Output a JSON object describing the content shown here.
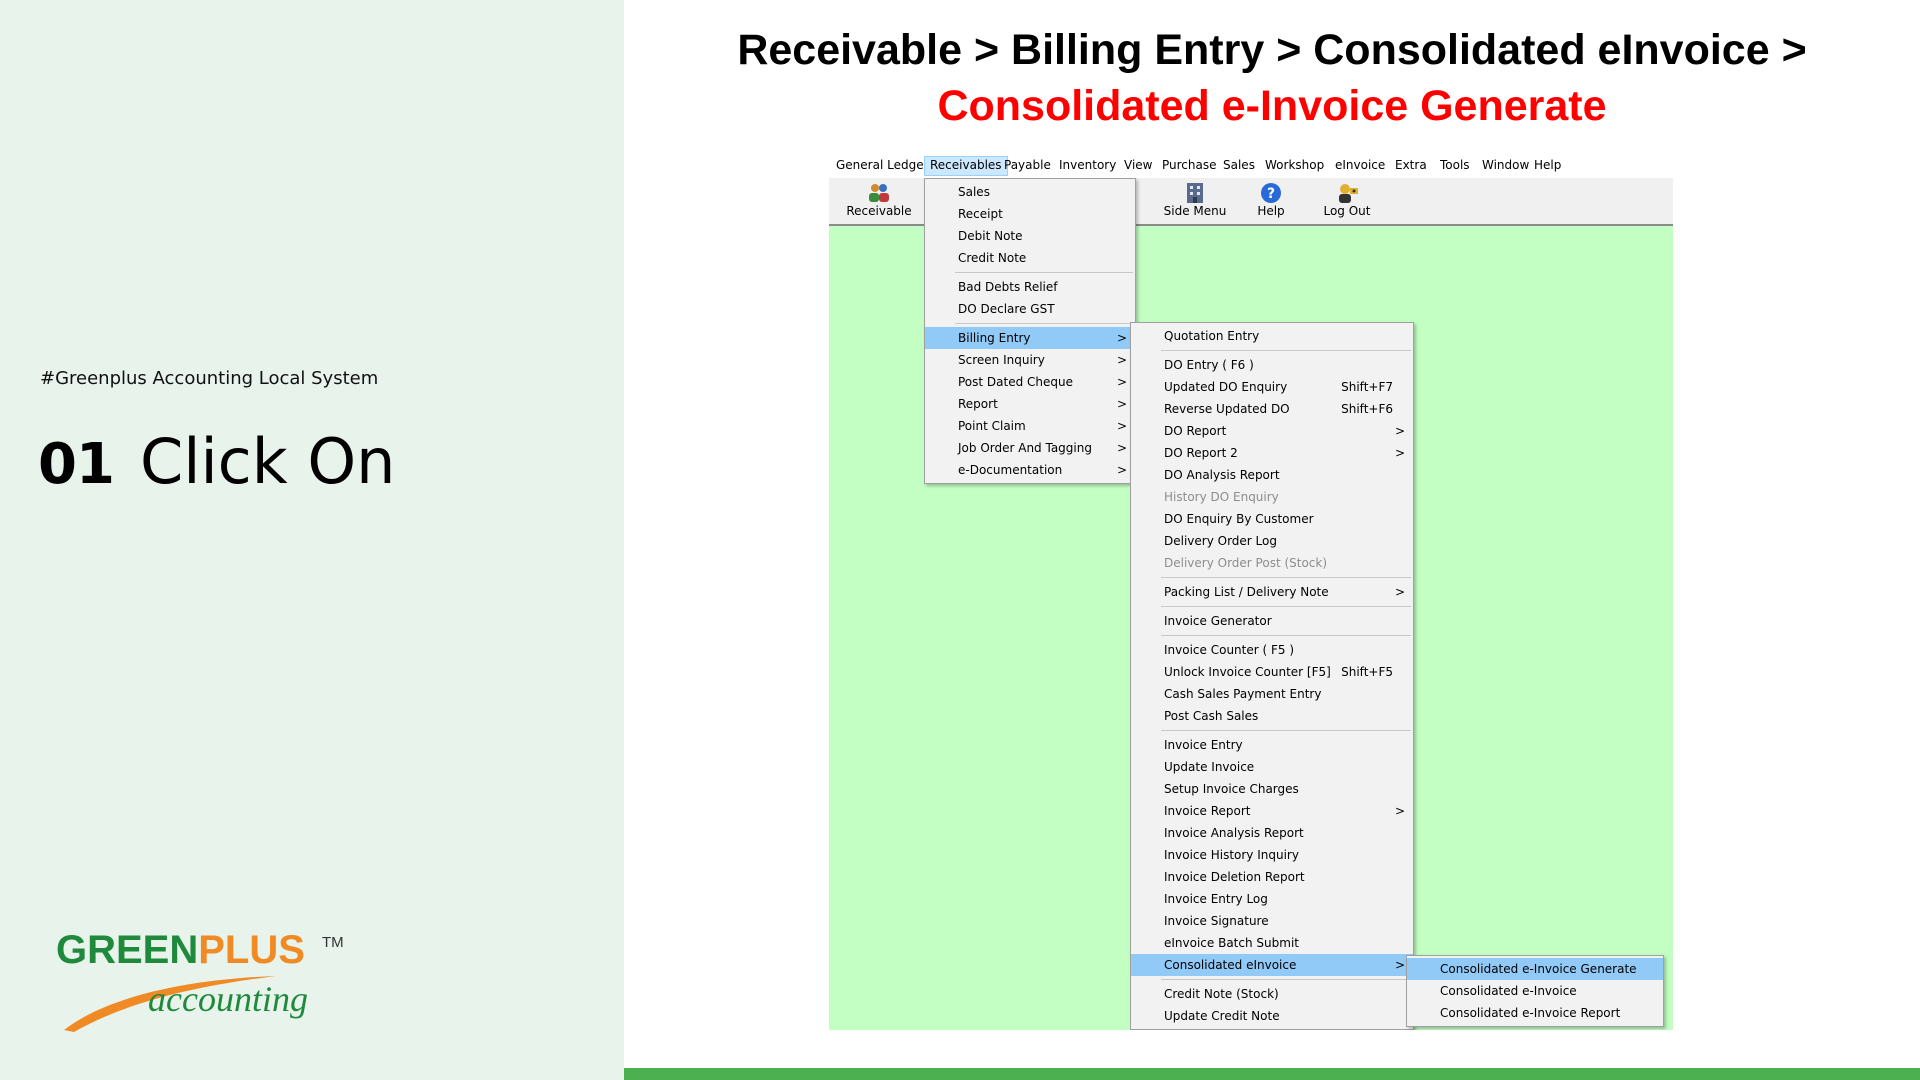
{
  "left": {
    "hashtag": "#Greenplus Accounting Local System",
    "step_number": "01",
    "step_text": "Click On"
  },
  "logo": {
    "green": "GREEN",
    "plus": "PLUS",
    "tm": "TM",
    "sub": "accounting"
  },
  "header": {
    "title_line1": "Receivable > Billing Entry > Consolidated eInvoice >",
    "title_line2": "Consolidated e-Invoice Generate"
  },
  "colors": {
    "left_panel_bg": "#e8f3ec",
    "title_highlight": "#ff0000",
    "app_bg": "#c3ffc3",
    "menu_highlight": "#91c9f7",
    "bottom_bar": "#4caf50",
    "brand_green": "#1f8a3c",
    "brand_orange": "#f08a24"
  },
  "menubar": {
    "items": [
      {
        "label": "General Ledger"
      },
      {
        "label": "Receivables"
      },
      {
        "label": "Payable"
      },
      {
        "label": "Inventory"
      },
      {
        "label": "View"
      },
      {
        "label": "Purchase"
      },
      {
        "label": "Sales"
      },
      {
        "label": "Workshop"
      },
      {
        "label": "eInvoice"
      },
      {
        "label": "Extra"
      },
      {
        "label": "Tools"
      },
      {
        "label": "Window"
      },
      {
        "label": "Help"
      }
    ]
  },
  "toolbar": {
    "buttons": [
      {
        "label": "Receivable",
        "icon": "users-icon"
      },
      {
        "label": "Side Menu",
        "icon": "building-icon"
      },
      {
        "label": "Help",
        "icon": "help-icon"
      },
      {
        "label": "Log Out",
        "icon": "logout-icon"
      }
    ]
  },
  "receivables_menu": {
    "group1": [
      "Sales",
      "Receipt",
      "Debit Note",
      "Credit Note"
    ],
    "group2": [
      "Bad Debts Relief",
      "DO Declare GST"
    ],
    "group3": [
      "Billing Entry",
      "Screen Inquiry",
      "Post Dated Cheque",
      "Report",
      "Point Claim",
      "Job Order And Tagging",
      "e-Documentation"
    ]
  },
  "billing_menu": {
    "quotation": "Quotation Entry",
    "do_group": {
      "do_entry": "DO Entry  ( F6 )",
      "updated_do": "Updated DO Enquiry",
      "updated_do_sc": "Shift+F7",
      "reverse_do": "Reverse Updated DO",
      "reverse_do_sc": "Shift+F6",
      "do_report": "DO Report",
      "do_report2": "DO Report 2",
      "do_analysis": "DO Analysis Report",
      "history_do": "History DO Enquiry",
      "do_by_customer": "DO Enquiry By Customer",
      "delivery_log": "Delivery Order Log",
      "delivery_post": "Delivery Order Post (Stock)"
    },
    "packing": "Packing List / Delivery Note",
    "invoice_generator": "Invoice Generator",
    "counter_group": {
      "invoice_counter": "Invoice Counter   ( F5 )",
      "unlock_counter": "Unlock Invoice Counter [F5]",
      "unlock_counter_sc": "Shift+F5",
      "cash_sales_payment": "Cash Sales Payment Entry",
      "post_cash_sales": "Post Cash Sales"
    },
    "invoice_group": {
      "invoice_entry": "Invoice Entry",
      "update_invoice": "Update Invoice",
      "setup_charges": "Setup Invoice Charges",
      "invoice_report": "Invoice Report",
      "invoice_analysis": "Invoice Analysis Report",
      "invoice_history": "Invoice History Inquiry",
      "invoice_deletion": "Invoice Deletion Report",
      "invoice_log": "Invoice Entry Log",
      "invoice_signature": "Invoice Signature",
      "einvoice_batch": "eInvoice Batch Submit",
      "consolidated": "Consolidated eInvoice"
    },
    "credit_group": {
      "credit_note_stock": "Credit Note (Stock)",
      "update_credit_note": "Update Credit Note"
    }
  },
  "consolidated_menu": {
    "items": [
      "Consolidated e-Invoice Generate",
      "Consolidated e-Invoice",
      "Consolidated e-Invoice Report"
    ]
  }
}
